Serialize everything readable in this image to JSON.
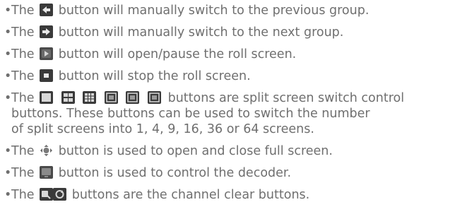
{
  "items": [
    {
      "prefix": "The",
      "suffix": "button will manually switch to the previous group.",
      "icons": [
        "arrow-left-icon"
      ]
    },
    {
      "prefix": "The",
      "suffix": "button will manually switch to the next group.",
      "icons": [
        "arrow-right-icon"
      ]
    },
    {
      "prefix": "The",
      "suffix": "button will open/pause the roll screen.",
      "icons": [
        "roll-screen-play-pause-icon"
      ]
    },
    {
      "prefix": "The",
      "suffix": "button will stop the roll screen.",
      "icons": [
        "stop-icon"
      ]
    },
    {
      "prefix": "The",
      "suffix": "buttons are split screen switch control",
      "line2": "buttons. These buttons can be used to switch the number",
      "line3": "of split screens into 1, 4, 9, 16, 36 or 64 screens.",
      "icons": [
        "split-1-icon",
        "split-4-icon",
        "split-9-icon",
        "split-16-icon",
        "split-36-icon",
        "split-64-icon"
      ]
    },
    {
      "prefix": "The",
      "suffix": "button is used to open and close full screen.",
      "icons": [
        "full-screen-icon"
      ]
    },
    {
      "prefix": "The",
      "suffix": "button is used to control the decoder.",
      "icons": [
        "decoder-icon"
      ]
    },
    {
      "prefix": "The",
      "suffix": "buttons are the channel clear buttons.",
      "icons": [
        "channel-clear-icon",
        "refresh-icon"
      ]
    }
  ],
  "bullet": "•"
}
